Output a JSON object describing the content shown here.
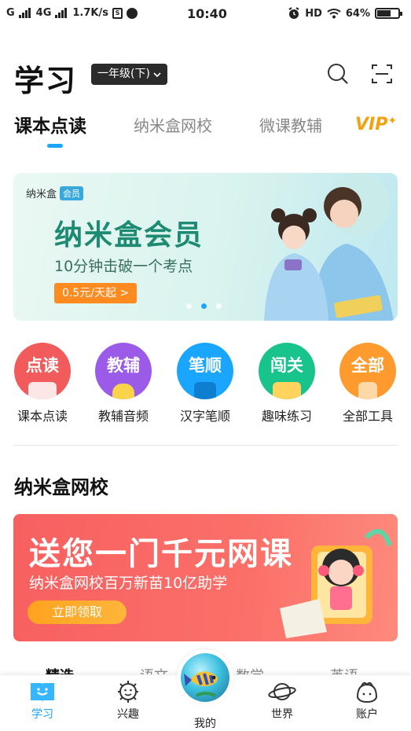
{
  "status_bar": {
    "carrier1": "G",
    "carrier2": "4G",
    "speed": "1.7K/s",
    "time": "10:40",
    "hd": "HD",
    "battery": "64%"
  },
  "header": {
    "title": "学习",
    "grade_label": "一年级(下)"
  },
  "tabs": [
    "课本点读",
    "纳米盒网校",
    "微课教辅"
  ],
  "vip_label": "VIP",
  "banner_member": {
    "brand": "纳米盒",
    "brand_tag": "会员",
    "title": "纳米盒会员",
    "subtitle": "10分钟击破一个考点",
    "price": "0.5元/天起 >",
    "active_slide": 1,
    "slide_count": 3
  },
  "tools": [
    {
      "glyph": "点读",
      "label": "课本点读",
      "color": "#f25b5b"
    },
    {
      "glyph": "教辅",
      "label": "教辅音频",
      "color": "#9b5ae8"
    },
    {
      "glyph": "笔顺",
      "label": "汉字笔顺",
      "color": "#1aa6ff"
    },
    {
      "glyph": "闯关",
      "label": "趣味练习",
      "color": "#19c38c"
    },
    {
      "glyph": "全部",
      "label": "全部工具",
      "color": "#ff9a2e"
    }
  ],
  "section": {
    "title": "纳米盒网校"
  },
  "banner_course": {
    "title": "送您一门千元网课",
    "subtitle": "纳米盒网校百万新苗10亿助学",
    "button": "立即领取"
  },
  "subtabs": [
    "精选",
    "语文",
    "数学",
    "英语"
  ],
  "bottom_nav": [
    {
      "label": "学习",
      "icon": "book-icon",
      "active": true
    },
    {
      "label": "兴趣",
      "icon": "sun-face-icon",
      "active": false
    },
    {
      "label": "我的",
      "icon": "fish-orb-icon",
      "active": false
    },
    {
      "label": "世界",
      "icon": "planet-icon",
      "active": false
    },
    {
      "label": "账户",
      "icon": "account-face-icon",
      "active": false
    }
  ],
  "colors": {
    "accent": "#1aa6ff",
    "vip": "#f3a10f",
    "banner_member_text": "#1d8a72",
    "banner_course_bg": "#f76060",
    "cta_orange": "#ffa21f"
  }
}
